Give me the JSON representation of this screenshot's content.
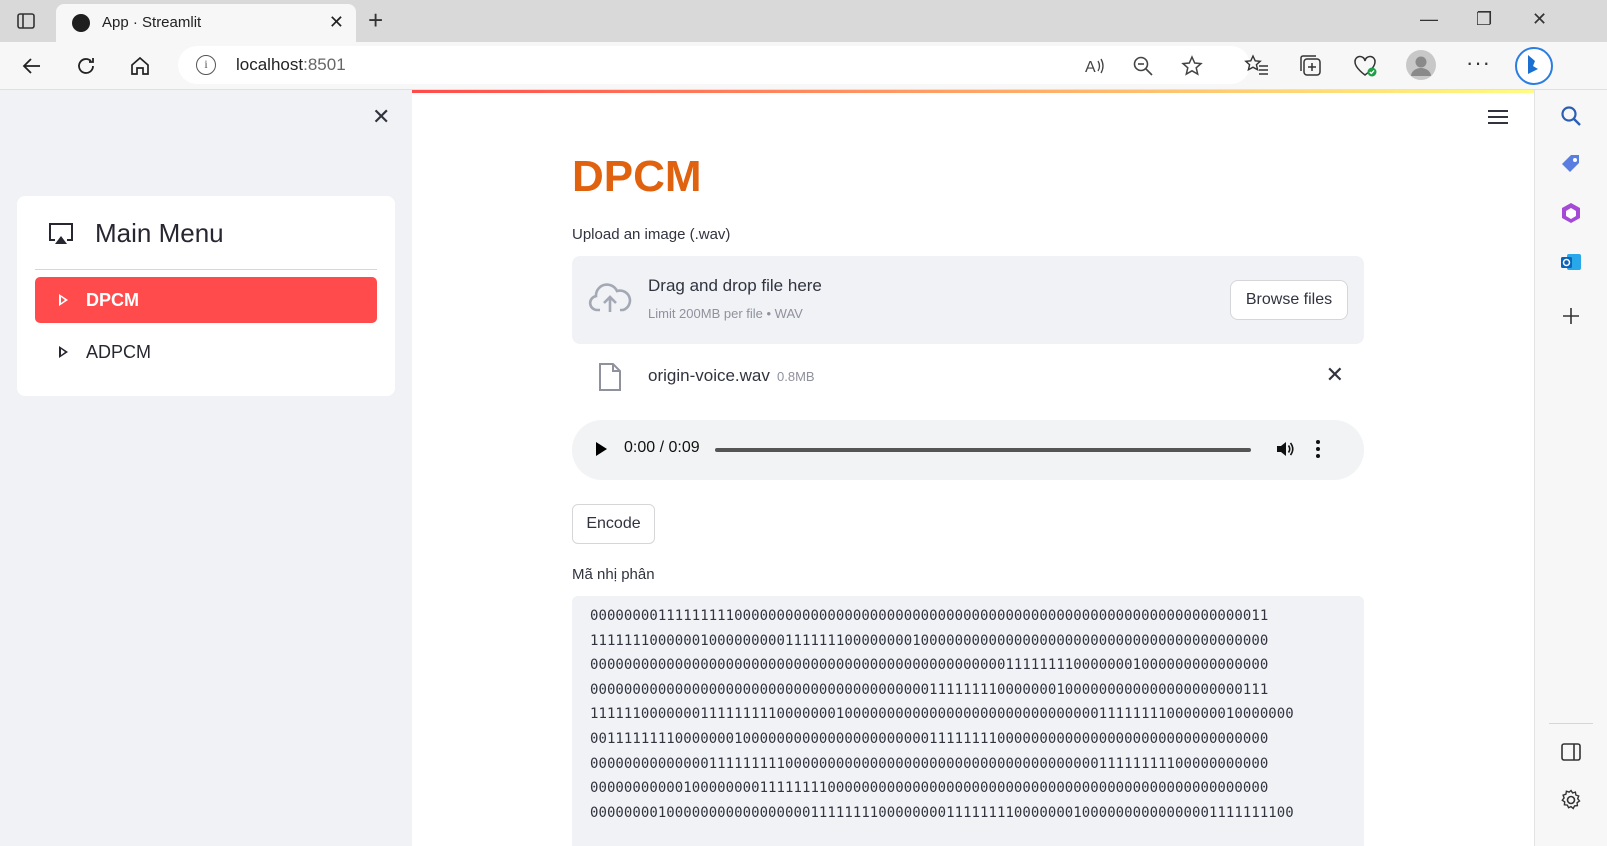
{
  "browser": {
    "tab_title": "App · Streamlit",
    "url_host": "localhost",
    "url_port": ":8501"
  },
  "sidebar": {
    "menu_title": "Main Menu",
    "items": [
      {
        "label": "DPCM",
        "active": true
      },
      {
        "label": "ADPCM",
        "active": false
      }
    ]
  },
  "main": {
    "title": "DPCM",
    "upload_label": "Upload an image (.wav)",
    "dropzone": {
      "main_text": "Drag and drop file here",
      "sub_text": "Limit 200MB per file • WAV",
      "browse_label": "Browse files"
    },
    "file": {
      "name": "origin-voice.wav",
      "size": "0.8MB"
    },
    "audio": {
      "time": "0:00 / 0:09",
      "progress": 0
    },
    "encode_label": "Encode",
    "binary_label": "Mã nhị phân",
    "binary_lines": [
      "00000000111111111000000000000000000000000000000000000000000000000000000000000011",
      "11111110000001000000000111111100000000100000000000000000000000000000000000000000",
      "00000000000000000000000000000000000000000000000001111111100000001000000000000000",
      "00000000000000000000000000000000000000001111111100000001000000000000000000000111",
      "11111100000001111111110000000100000000000000000000000000000011111111000000010000000",
      "00111111110000000100000000000000000000001111111100000000000000000000000000000000",
      "00000000000000111111111000000000000000000000000000000000000011111111100000000000",
      "00000000000100000000111111110000000000000000000000000000000000000000000000000000",
      "00000000100000000000000000111111110000000011111111000000010000000000000001111111100"
    ]
  },
  "colors": {
    "accent": "#ff4b4b",
    "title": "#e0620f"
  }
}
